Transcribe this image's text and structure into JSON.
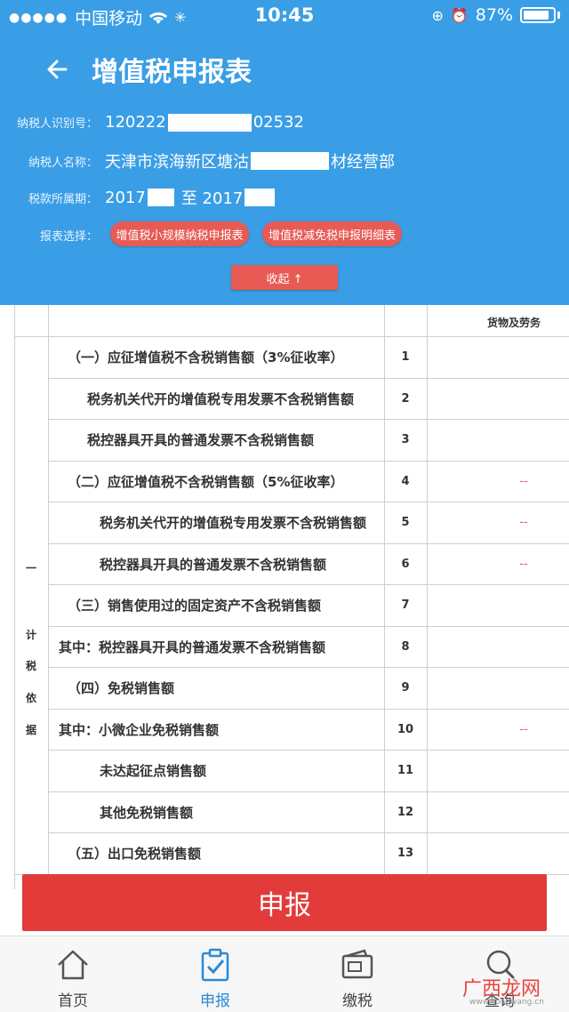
{
  "status_bar": {
    "carrier": "中国移动",
    "time": "10:45",
    "battery": "87%"
  },
  "header": {
    "title": "增值税申报表",
    "taxpayer_id_label": "纳税人识别号：",
    "taxpayer_id_prefix": "120222",
    "taxpayer_id_suffix": "02532",
    "taxpayer_name_label": "纳税人名称：",
    "taxpayer_name_prefix": "天津市滨海新区塘沽",
    "taxpayer_name_suffix": "材经营部",
    "period_label": "税款所属期：",
    "period_start": "2017",
    "period_sep": "至 2017",
    "form_select_label": "报表选择：",
    "form_options": [
      "增值税小规模纳税申报表",
      "增值税减免税申报明细表"
    ],
    "collapse_label": "收起 ↑"
  },
  "table": {
    "column_header": "货物及劳务",
    "side_label_top": "一",
    "side_label_chars": [
      "计",
      "税",
      "依",
      "据"
    ],
    "rows": [
      {
        "label": "（一）应征增值税不含税销售额（3%征收率）",
        "num": "1",
        "dash": ""
      },
      {
        "label": "税务机关代开的增值税专用发票不含税销售额",
        "num": "2",
        "dash": ""
      },
      {
        "label": "税控器具开具的普通发票不含税销售额",
        "num": "3",
        "dash": ""
      },
      {
        "label": "（二）应征增值税不含税销售额（5%征收率）",
        "num": "4",
        "dash": "--"
      },
      {
        "label": "税务机关代开的增值税专用发票不含税销售额",
        "num": "5",
        "dash": "--"
      },
      {
        "label": "税控器具开具的普通发票不含税销售额",
        "num": "6",
        "dash": "--"
      },
      {
        "label": "（三）销售使用过的固定资产不含税销售额",
        "num": "7",
        "dash": ""
      },
      {
        "label": "其中：税控器具开具的普通发票不含税销售额",
        "num": "8",
        "dash": ""
      },
      {
        "label": "（四）免税销售额",
        "num": "9",
        "dash": ""
      },
      {
        "label": "其中：小微企业免税销售额",
        "num": "10",
        "dash": "--"
      },
      {
        "label": "未达起征点销售额",
        "num": "11",
        "dash": ""
      },
      {
        "label": "其他免税销售额",
        "num": "12",
        "dash": ""
      },
      {
        "label": "（五）出口免税销售额",
        "num": "13",
        "dash": ""
      }
    ]
  },
  "submit_label": "申报",
  "tabs": [
    {
      "label": "首页",
      "icon": "home-icon"
    },
    {
      "label": "申报",
      "icon": "clipboard-check-icon"
    },
    {
      "label": "缴税",
      "icon": "wallet-icon"
    },
    {
      "label": "查询",
      "icon": "search-icon"
    }
  ],
  "watermark": {
    "text": "广西龙网",
    "sub": "www.ilongwang.cn"
  },
  "colors": {
    "header_blue": "#3a9ee6",
    "pill_red": "#e85a54",
    "submit_red": "#e23b3a",
    "active_tab": "#2b8ad6"
  }
}
